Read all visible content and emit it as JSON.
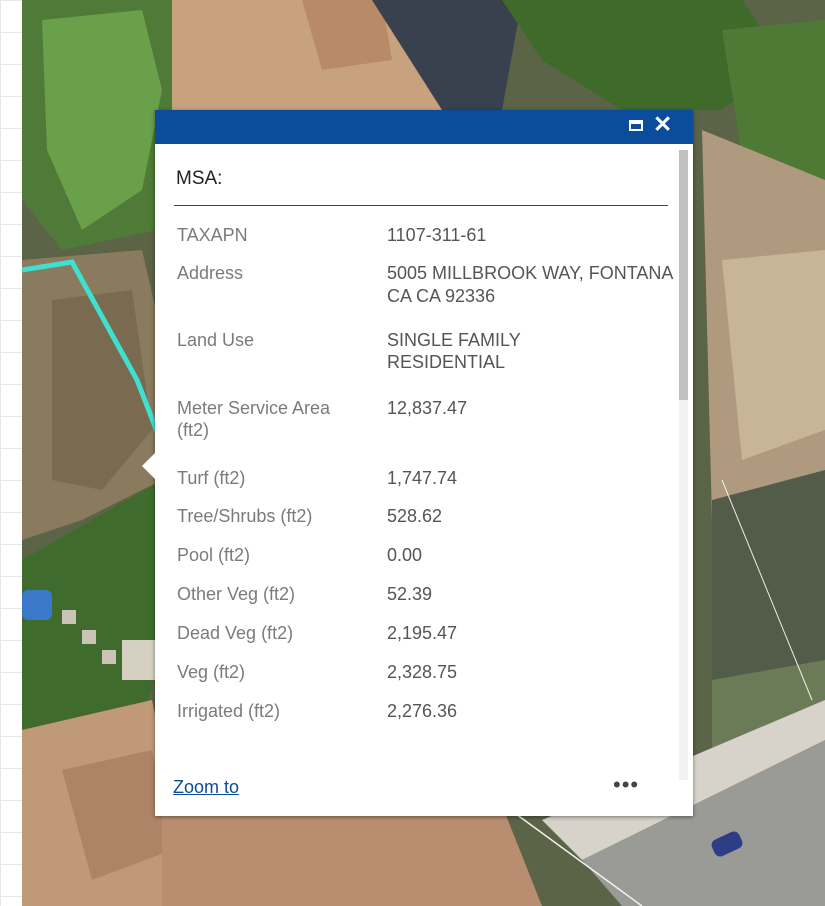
{
  "popup": {
    "title": "MSA:",
    "zoom_label": "Zoom to",
    "more_label": "•••",
    "close_label": "✕",
    "attributes": [
      {
        "label": "TAXAPN",
        "value": "1107-311-61"
      },
      {
        "label": "Address",
        "value": "5005 MILLBROOK WAY, FONTANA CA CA 92336"
      },
      {
        "label": "Land Use",
        "value": "SINGLE FAMILY RESIDENTIAL"
      },
      {
        "label": "Meter Service Area (ft2)",
        "value": "12,837.47"
      },
      {
        "label": "Turf (ft2)",
        "value": "1,747.74"
      },
      {
        "label": "Tree/Shrubs (ft2)",
        "value": "528.62"
      },
      {
        "label": "Pool (ft2)",
        "value": "0.00"
      },
      {
        "label": "Other Veg (ft2)",
        "value": "52.39"
      },
      {
        "label": "Dead Veg (ft2)",
        "value": "2,195.47"
      },
      {
        "label": "Veg (ft2)",
        "value": "2,328.75"
      },
      {
        "label": "Irrigated (ft2)",
        "value": "2,276.36"
      }
    ]
  },
  "colors": {
    "header": "#0b4c9c",
    "parcel_outline": "#3fe0d0"
  }
}
